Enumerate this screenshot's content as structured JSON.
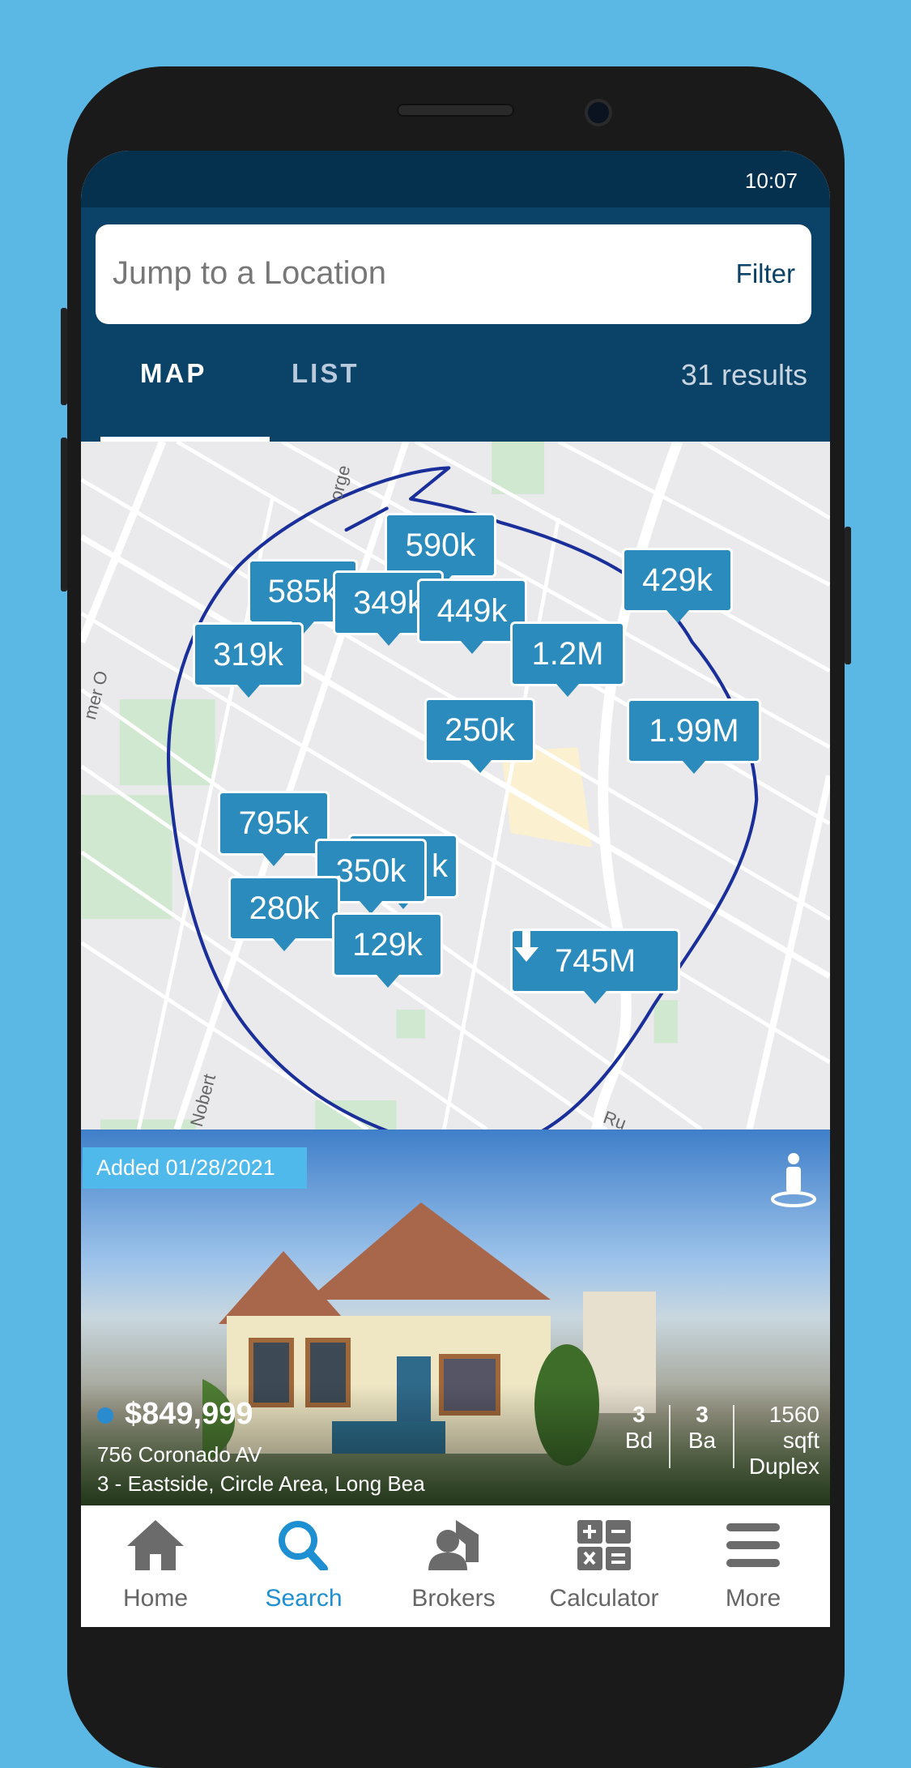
{
  "status_bar": {
    "time": "10:07"
  },
  "search": {
    "placeholder": "Jump to a Location",
    "filter_label": "Filter"
  },
  "tabs": [
    {
      "label": "MAP",
      "active": true
    },
    {
      "label": "LIST",
      "active": false
    }
  ],
  "results_count": "31 results",
  "map": {
    "streets": [
      "orge",
      "Nobert",
      "Ru",
      "mer O"
    ],
    "markers": [
      {
        "label": "590k"
      },
      {
        "label": "585k"
      },
      {
        "label": "349k"
      },
      {
        "label": "449k"
      },
      {
        "label": "319k"
      },
      {
        "label": "429k"
      },
      {
        "label": "1.2M"
      },
      {
        "label": "250k"
      },
      {
        "label": "1.99M"
      },
      {
        "label": "795k"
      },
      {
        "label": "k"
      },
      {
        "label": "350k"
      },
      {
        "label": "280k"
      },
      {
        "label": "129k"
      },
      {
        "label": "745M",
        "icon": "arrow-down-icon"
      }
    ],
    "marker_color": "#2a8bbc",
    "drawn_boundary_color": "#1a2f9a"
  },
  "listing": {
    "added": "Added 01/28/2021",
    "price": "$849,999",
    "address": "756 Coronado AV",
    "area": "3 - Eastside, Circle Area, Long Bea",
    "beds": "3",
    "beds_label": "Bd",
    "baths": "3",
    "baths_label": "Ba",
    "sqft": "1560",
    "sqft_label": "sqft",
    "type": "Duplex"
  },
  "bottom_nav": [
    {
      "label": "Home",
      "icon": "home-icon"
    },
    {
      "label": "Search",
      "icon": "search-icon",
      "active": true
    },
    {
      "label": "Brokers",
      "icon": "broker-icon"
    },
    {
      "label": "Calculator",
      "icon": "calculator-icon"
    },
    {
      "label": "More",
      "icon": "menu-icon"
    }
  ],
  "colors": {
    "header": "#0a4268",
    "accent": "#1e8fd0",
    "badge": "#4fb9ec"
  }
}
